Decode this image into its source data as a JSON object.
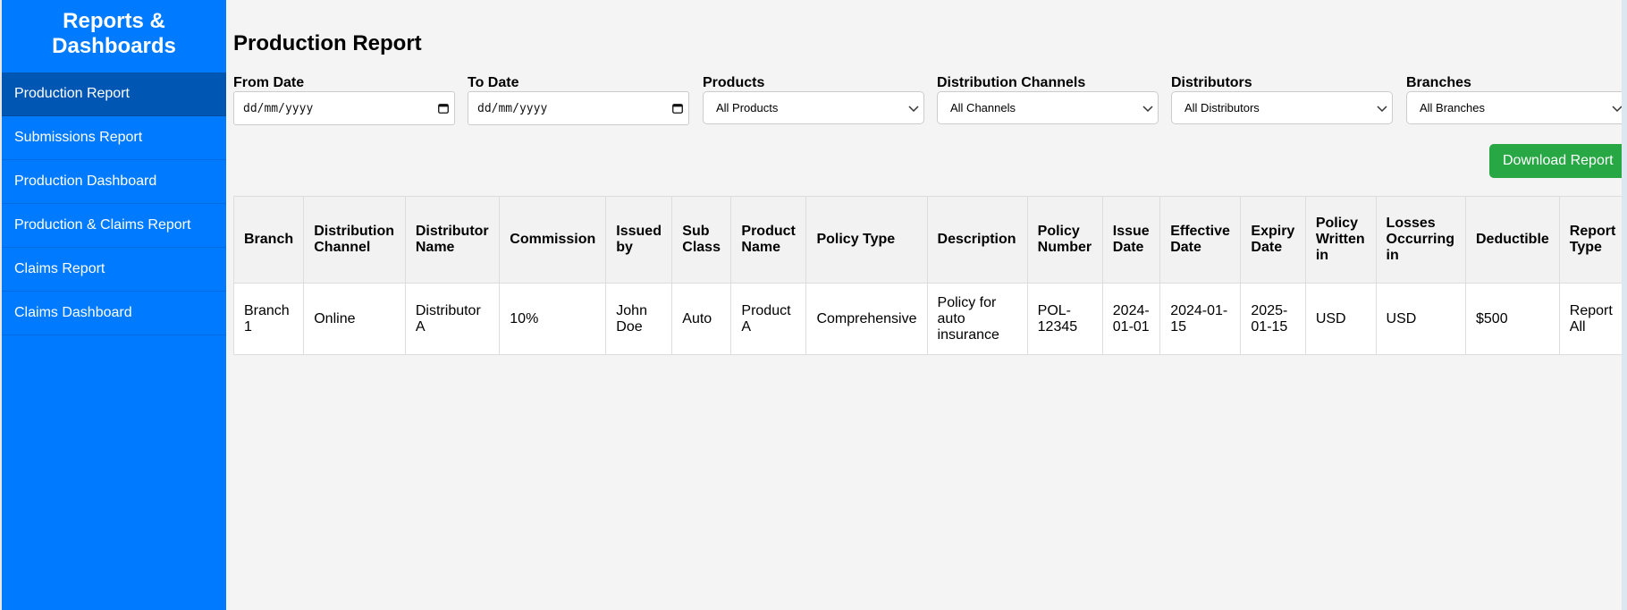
{
  "sidebar": {
    "title": "Reports & Dashboards",
    "items": [
      {
        "label": "Production Report"
      },
      {
        "label": "Submissions Report"
      },
      {
        "label": "Production Dashboard"
      },
      {
        "label": "Production & Claims Report"
      },
      {
        "label": "Claims Report"
      },
      {
        "label": "Claims Dashboard"
      }
    ]
  },
  "main": {
    "title": "Production Report",
    "filters": {
      "from_date": {
        "label": "From Date",
        "placeholder": "dd/mm/yyyy"
      },
      "to_date": {
        "label": "To Date",
        "placeholder": "dd/mm/yyyy"
      },
      "products": {
        "label": "Products",
        "value": "All Products"
      },
      "channels": {
        "label": "Distribution Channels",
        "value": "All Channels"
      },
      "distributors": {
        "label": "Distributors",
        "value": "All Distributors"
      },
      "branches": {
        "label": "Branches",
        "value": "All Branches"
      }
    },
    "download_label": "Download Report",
    "table": {
      "headers": [
        "Branch",
        "Distribution Channel",
        "Distributor Name",
        "Commission",
        "Issued by",
        "Sub Class",
        "Product Name",
        "Policy Type",
        "Description",
        "Policy Number",
        "Issue Date",
        "Effective Date",
        "Expiry Date",
        "Policy Written in",
        "Losses Occurring in",
        "Deductible",
        "Report Type"
      ],
      "rows": [
        [
          "Branch 1",
          "Online",
          "Distributor A",
          "10%",
          "John Doe",
          "Auto",
          "Product A",
          "Comprehensive",
          "Policy for auto insurance",
          "POL-12345",
          "2024-01-01",
          "2024-01-15",
          "2025-01-15",
          "USD",
          "USD",
          "$500",
          "Report All"
        ]
      ]
    }
  },
  "icons": {
    "date": "calendar-icon",
    "select": "chevron-down-icon"
  },
  "colors": {
    "sidebar": "#007bff",
    "sidebar_active": "#0056b3",
    "download_button": "#28a745"
  }
}
